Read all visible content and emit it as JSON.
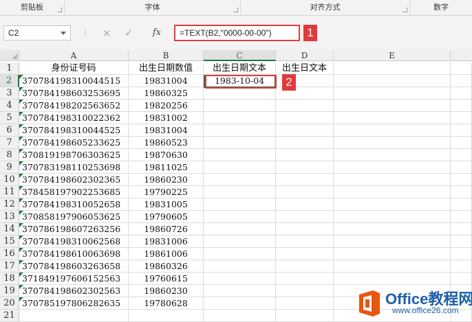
{
  "ribbon": {
    "groups": [
      {
        "label": "剪贴板"
      },
      {
        "label": "字体"
      },
      {
        "label": "对齐方式"
      },
      {
        "label": "数字"
      }
    ]
  },
  "formula_bar": {
    "name_box": "C2",
    "cancel_icon": "×",
    "enter_icon": "✓",
    "fx_label": "fx",
    "formula": "=TEXT(B2,\"0000-00-00\")"
  },
  "annotations": {
    "badge1": "1",
    "badge2": "2"
  },
  "columns": [
    "A",
    "B",
    "C",
    "D",
    "E"
  ],
  "selected_cell": "C2",
  "headers_row": [
    "身份证号码",
    "出生日期数值",
    "出生日期文本",
    "出生日文本"
  ],
  "rows": [
    {
      "num": "1"
    },
    {
      "num": "2",
      "id": "370784198310044515",
      "date": "19831004",
      "text": "1983-10-04"
    },
    {
      "num": "3",
      "id": "370784198603253695",
      "date": "19860325"
    },
    {
      "num": "4",
      "id": "370784198202563652",
      "date": "19820256"
    },
    {
      "num": "5",
      "id": "370784198310022362",
      "date": "19831002"
    },
    {
      "num": "6",
      "id": "370784198310044525",
      "date": "19831004"
    },
    {
      "num": "7",
      "id": "370784198605233625",
      "date": "19860523"
    },
    {
      "num": "8",
      "id": "370819198706303625",
      "date": "19870630"
    },
    {
      "num": "9",
      "id": "370783198110253698",
      "date": "19811025"
    },
    {
      "num": "10",
      "id": "370784198602302365",
      "date": "19860230"
    },
    {
      "num": "11",
      "id": "378458197902253685",
      "date": "19790225"
    },
    {
      "num": "12",
      "id": "370784198310052658",
      "date": "19831005"
    },
    {
      "num": "13",
      "id": "370858197906053625",
      "date": "19790605"
    },
    {
      "num": "14",
      "id": "370786198607263256",
      "date": "19860726"
    },
    {
      "num": "15",
      "id": "370784198310062568",
      "date": "19831006"
    },
    {
      "num": "16",
      "id": "370784198610063698",
      "date": "19861006"
    },
    {
      "num": "17",
      "id": "370784198603263658",
      "date": "19860326"
    },
    {
      "num": "18",
      "id": "371849197606152563",
      "date": "19760615"
    },
    {
      "num": "19",
      "id": "370784198602302563",
      "date": "19860230"
    },
    {
      "num": "20",
      "id": "370785197806282635",
      "date": "19780628"
    },
    {
      "num": "21"
    }
  ],
  "watermark": {
    "brand": "Office教程网",
    "url": "www.office26.com"
  },
  "colors": {
    "excel_green": "#217346",
    "annotation_red": "#e23b3b",
    "brand_blue": "#1e5fa8",
    "brand_orange": "#e8560f"
  }
}
